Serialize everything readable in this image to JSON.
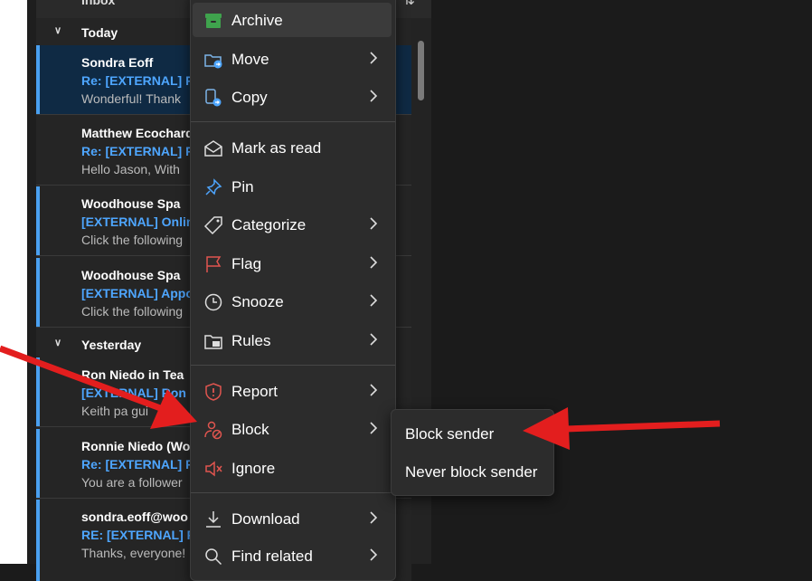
{
  "mail_list": {
    "top_label": "Inbox",
    "groups": [
      {
        "label": "Today"
      },
      {
        "label": "Yesterday"
      }
    ],
    "messages": [
      {
        "sender": "Sondra Eoff",
        "subject": "Re: [EXTERNAL] R",
        "preview": "Wonderful! Thank"
      },
      {
        "sender": "Matthew Ecochard",
        "subject": "Re: [EXTERNAL] R",
        "preview": "Hello Jason, With"
      },
      {
        "sender": "Woodhouse Spa",
        "subject": "[EXTERNAL] Onlin",
        "preview": "Click the following"
      },
      {
        "sender": "Woodhouse Spa",
        "subject": "[EXTERNAL] Appo",
        "preview": "Click the following"
      },
      {
        "sender": "Ron Niedo in Tea",
        "subject": "[EXTERNAL] Ron",
        "preview": "Keith pa gui"
      },
      {
        "sender": "Ronnie Niedo (Wo",
        "subject": "Re: [EXTERNAL] F",
        "preview": "You are a follower"
      },
      {
        "sender": "sondra.eoff@woo",
        "subject": "RE: [EXTERNAL] R",
        "preview": "Thanks, everyone!"
      }
    ]
  },
  "context_menu": {
    "items": [
      {
        "label": "Archive",
        "icon": "archive-icon",
        "submenu": false
      },
      {
        "label": "Move",
        "icon": "folder-move-icon",
        "submenu": true
      },
      {
        "label": "Copy",
        "icon": "copy-icon",
        "submenu": true
      },
      {
        "label": "Mark as read",
        "icon": "envelope-open-icon",
        "submenu": false
      },
      {
        "label": "Pin",
        "icon": "pin-icon",
        "submenu": false
      },
      {
        "label": "Categorize",
        "icon": "tag-icon",
        "submenu": true
      },
      {
        "label": "Flag",
        "icon": "flag-icon",
        "submenu": true
      },
      {
        "label": "Snooze",
        "icon": "clock-icon",
        "submenu": true
      },
      {
        "label": "Rules",
        "icon": "rules-icon",
        "submenu": true
      },
      {
        "label": "Report",
        "icon": "shield-alert-icon",
        "submenu": true
      },
      {
        "label": "Block",
        "icon": "person-block-icon",
        "submenu": true
      },
      {
        "label": "Ignore",
        "icon": "speaker-mute-icon",
        "submenu": false
      },
      {
        "label": "Download",
        "icon": "download-icon",
        "submenu": true
      },
      {
        "label": "Find related",
        "icon": "search-icon",
        "submenu": true
      }
    ]
  },
  "block_submenu": {
    "items": [
      {
        "label": "Block sender"
      },
      {
        "label": "Never block sender"
      }
    ]
  },
  "colors": {
    "accent_blue": "#4ea6ff",
    "selected_row": "#0f2a44",
    "archive_green": "#3fa34d",
    "danger_red": "#e0554f",
    "annotation_arrow": "#e31e1e"
  }
}
